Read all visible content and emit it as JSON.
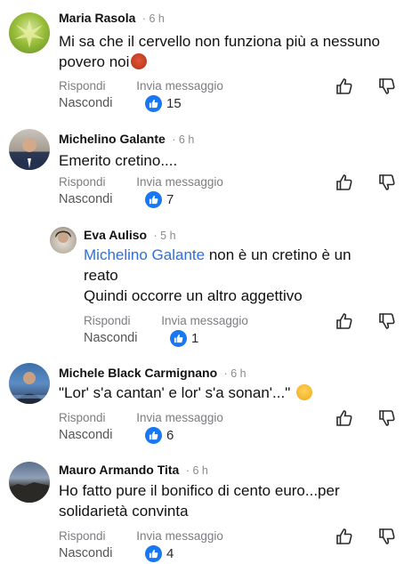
{
  "comments": [
    {
      "author": "Maria Rasola",
      "time": "· 6 h",
      "text_lines": [
        "Mi sa che il cervello non funziona più a nessuno",
        "povero noi"
      ],
      "reply": "Rispondi",
      "message": "Invia messaggio",
      "hide": "Nascondi",
      "likes": "15",
      "emoji": "angry-face-icon"
    },
    {
      "author": "Michelino Galante",
      "time": "· 6 h",
      "text_lines": [
        "Emerito cretino...."
      ],
      "reply": "Rispondi",
      "message": "Invia messaggio",
      "hide": "Nascondi",
      "likes": "7"
    },
    {
      "author": "Eva Auliso",
      "time": "· 5 h",
      "mention": "Michelino Galante",
      "text_lines": [
        "non è un cretino è un",
        "reato",
        "Quindi occorre un altro aggettivo"
      ],
      "reply": "Rispondi",
      "message": "Invia messaggio",
      "hide": "Nascondi",
      "likes": "1"
    },
    {
      "author": "Michele Black Carmignano",
      "time": "· 6 h",
      "text_lines": [
        "\"Lor' s'a cantan' e lor' s'a sonan'...\""
      ],
      "reply": "Rispondi",
      "message": "Invia messaggio",
      "hide": "Nascondi",
      "likes": "6",
      "emoji": "grimace-face-icon"
    },
    {
      "author": "Mauro Armando Tita",
      "time": "· 6 h",
      "text_lines": [
        "Ho fatto pure il bonifico di cento euro...per",
        "solidarietà convinta"
      ],
      "reply": "Rispondi",
      "message": "Invia messaggio",
      "hide": "Nascondi",
      "likes": "4"
    }
  ],
  "colors": {
    "like_blue": "#1877f2",
    "mention_blue": "#2f6fd6",
    "meta_gray": "#7d7d82"
  }
}
